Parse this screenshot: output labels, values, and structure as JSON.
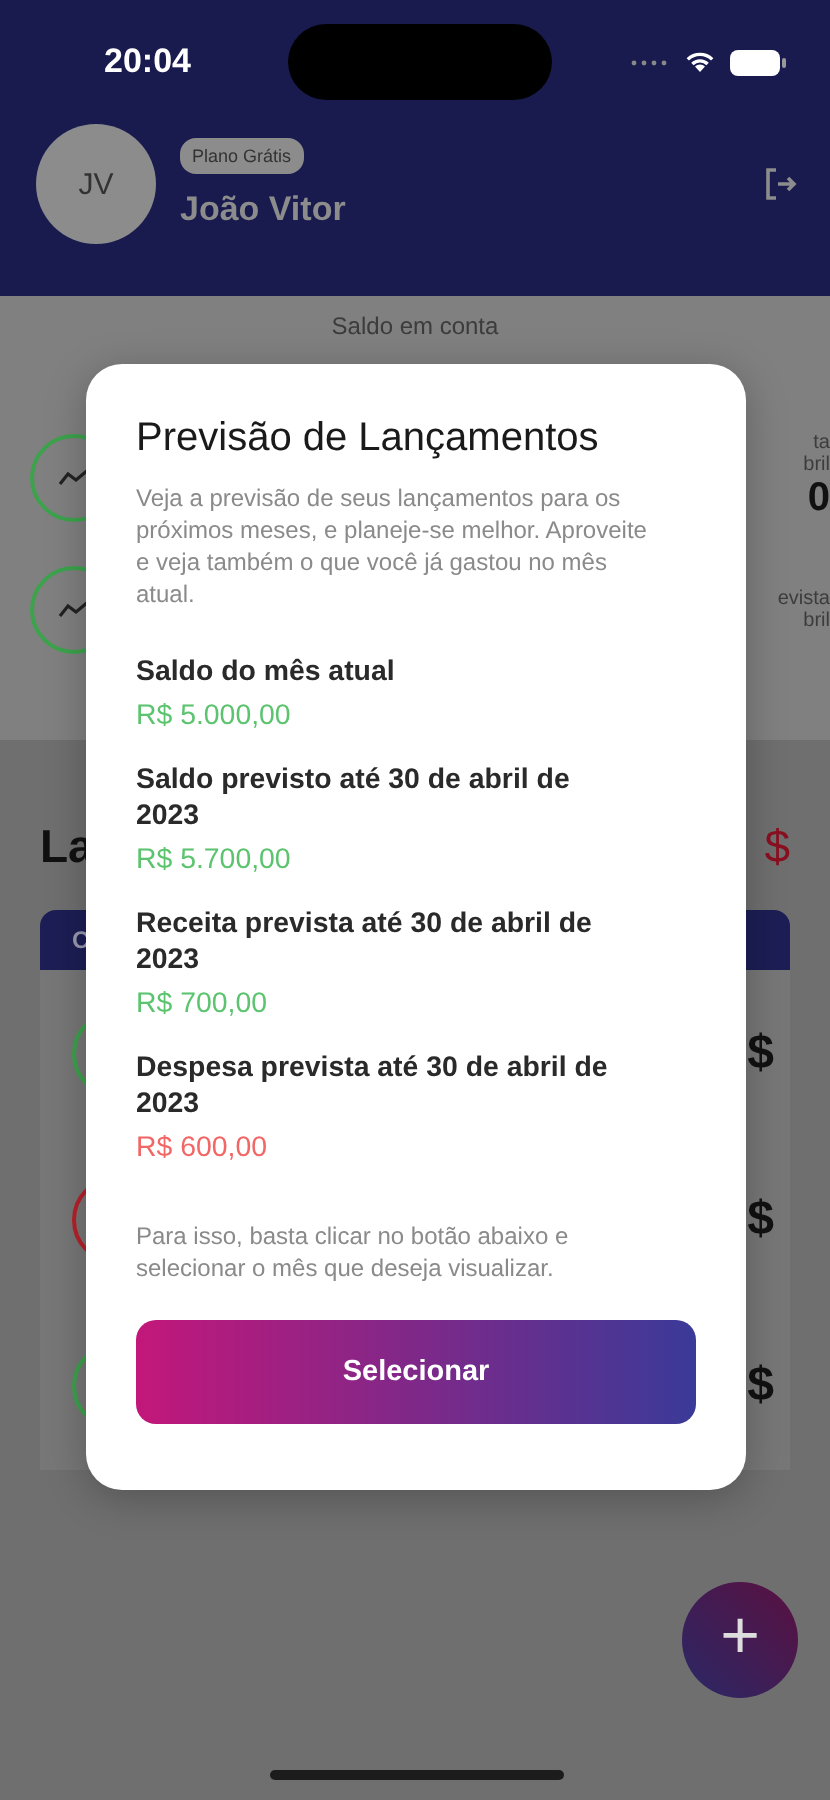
{
  "status_bar": {
    "time": "20:04"
  },
  "profile": {
    "initials": "JV",
    "plan": "Plano Grátis",
    "name": "João Vitor"
  },
  "balance": {
    "label": "Saldo em conta"
  },
  "summary_cards": [
    {
      "color": "#3ca34c",
      "lines": [
        "ta",
        "bril"
      ],
      "value": "0"
    },
    {
      "color": "#3ca34c",
      "lines": [
        "evista",
        "bril"
      ]
    }
  ],
  "transactions": {
    "heading": "La",
    "heading_right": "$",
    "tab": "C",
    "rows": [
      {
        "color": "#3ca34c",
        "amount": "$"
      },
      {
        "color": "#b8202a",
        "amount": "$"
      },
      {
        "color": "#3ca34c",
        "amount": "$"
      }
    ]
  },
  "fab": {
    "label": "+"
  },
  "modal": {
    "title": "Previsão de Lançamentos",
    "description": "Veja a previsão de seus lançamentos para os próximos meses, e planeje-se melhor. Aproveite e veja também o que você já gastou no mês atual.",
    "items": [
      {
        "label": "Saldo do mês atual",
        "value": "R$ 5.000,00",
        "kind": "positive"
      },
      {
        "label": "Saldo previsto até 30 de abril de 2023",
        "value": "R$ 5.700,00",
        "kind": "positive"
      },
      {
        "label": "Receita prevista até 30 de abril de 2023",
        "value": "R$ 700,00",
        "kind": "positive"
      },
      {
        "label": "Despesa prevista até 30 de abril de 2023",
        "value": "R$ 600,00",
        "kind": "negative"
      }
    ],
    "note": "Para isso, basta clicar no botão abaixo e selecionar o mês que deseja visualizar.",
    "button": "Selecionar"
  }
}
